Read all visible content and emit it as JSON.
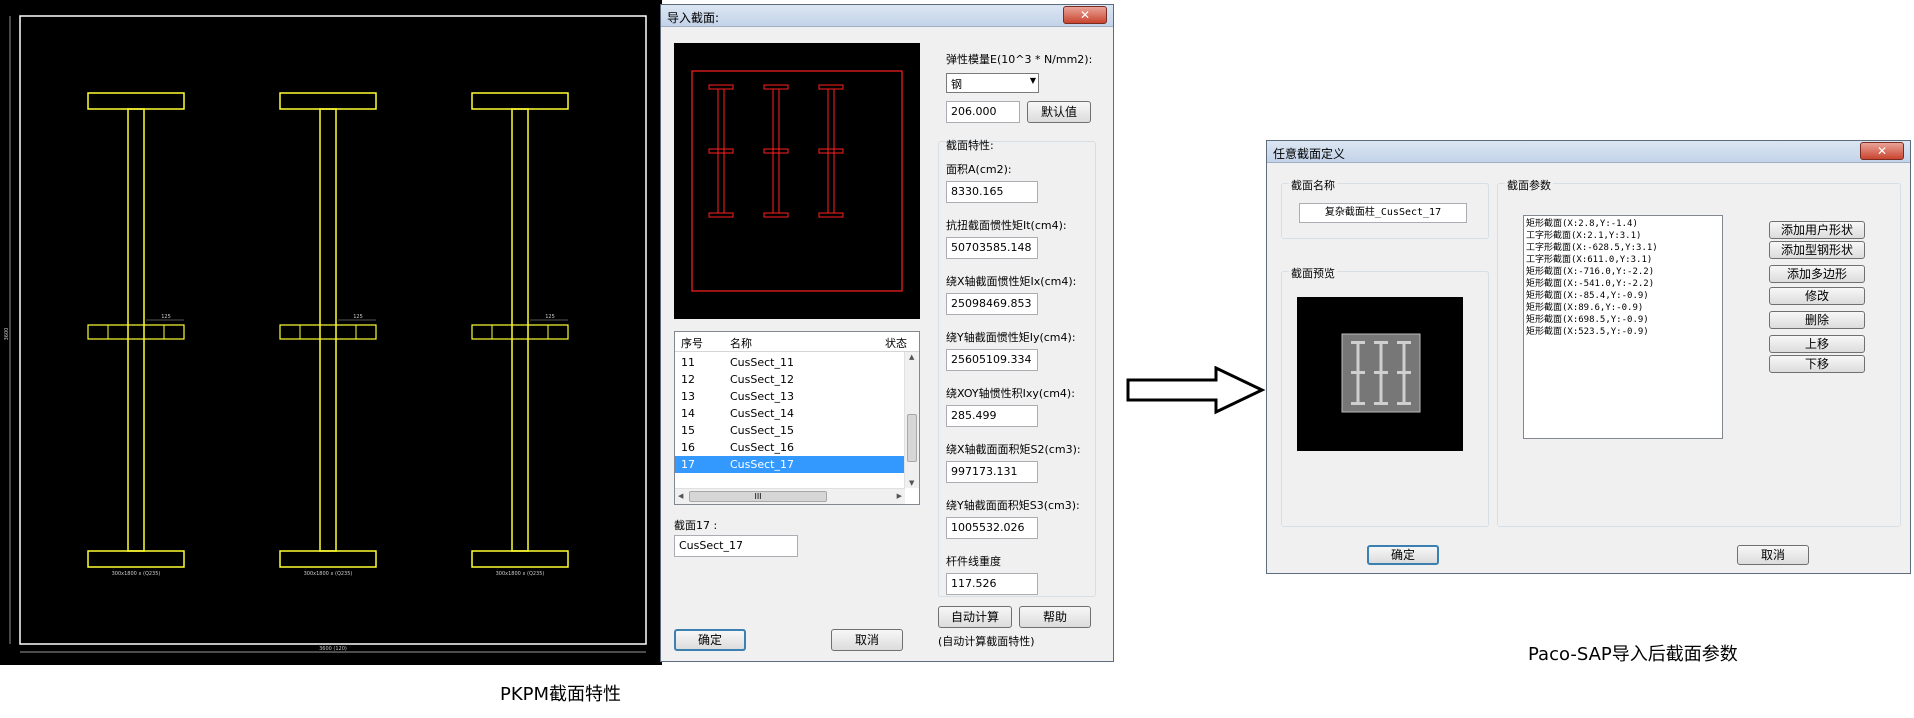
{
  "cad": {
    "top_dim": "125",
    "bottom_label": "300x1800 x (Q235)",
    "bottom_dim": "3600 (120)",
    "left_dim": "3600"
  },
  "import_dialog": {
    "title": "导入截面:",
    "close_glyph": "✕",
    "modulus_label": "弹性模量E(10^3 * N/mm2):",
    "material_value": "钢",
    "modulus_value": "206.000",
    "default_button": "默认值",
    "properties_group": "截面特性:",
    "props": [
      {
        "label": "面积A(cm2):",
        "value": "8330.165"
      },
      {
        "label": "抗扭截面惯性矩It(cm4):",
        "value": "50703585.148"
      },
      {
        "label": "绕X轴截面惯性矩Ix(cm4):",
        "value": "25098469.853"
      },
      {
        "label": "绕Y轴截面惯性矩Iy(cm4):",
        "value": "25605109.334"
      },
      {
        "label": "绕XOY轴惯性积Ixy(cm4):",
        "value": "285.499"
      },
      {
        "label": "绕X轴截面面积矩S2(cm3):",
        "value": "997173.131"
      },
      {
        "label": "绕Y轴截面面积矩S3(cm3):",
        "value": "1005532.026"
      },
      {
        "label": "杆件线重度",
        "value": "117.526"
      }
    ],
    "list_headers": [
      "序号",
      "名称",
      "状态"
    ],
    "list_rows": [
      {
        "no": "11",
        "name": "CusSect_11"
      },
      {
        "no": "12",
        "name": "CusSect_12"
      },
      {
        "no": "13",
        "name": "CusSect_13"
      },
      {
        "no": "14",
        "name": "CusSect_14"
      },
      {
        "no": "15",
        "name": "CusSect_15"
      },
      {
        "no": "16",
        "name": "CusSect_16"
      },
      {
        "no": "17",
        "name": "CusSect_17"
      }
    ],
    "scroll_thumb_text": "III",
    "section_label": "截面17 :",
    "section_value": "CusSect_17",
    "auto_calc_button": "自动计算",
    "help_button": "帮助",
    "auto_calc_note": "(自动计算截面特性)",
    "ok_button": "确定",
    "cancel_button": "取消"
  },
  "section_dialog": {
    "title": "任意截面定义",
    "close_glyph": "✕",
    "name_group": "截面名称",
    "name_value": "复杂截面柱_CusSect_17",
    "preview_group": "截面预览",
    "param_group": "截面参数",
    "shapes": [
      "矩形截面(X:2.8,Y:-1.4)",
      "工字形截面(X:2.1,Y:3.1)",
      "工字形截面(X:-628.5,Y:3.1)",
      "工字形截面(X:611.0,Y:3.1)",
      "矩形截面(X:-716.0,Y:-2.2)",
      "矩形截面(X:-541.0,Y:-2.2)",
      "矩形截面(X:-85.4,Y:-0.9)",
      "矩形截面(X:89.6,Y:-0.9)",
      "矩形截面(X:698.5,Y:-0.9)",
      "矩形截面(X:523.5,Y:-0.9)"
    ],
    "buttons": [
      "添加用户形状",
      "添加型钢形状",
      "添加多边形",
      "修改",
      "删除",
      "上移",
      "下移"
    ],
    "ok_button": "确定",
    "cancel_button": "取消"
  },
  "captions": {
    "left": "PKPM截面特性",
    "right": "Paco-SAP导入后截面参数"
  },
  "colors": {
    "cad_yellow": "#ffff33",
    "preview_red": "#ff2020",
    "selection_blue": "#3399ff"
  }
}
